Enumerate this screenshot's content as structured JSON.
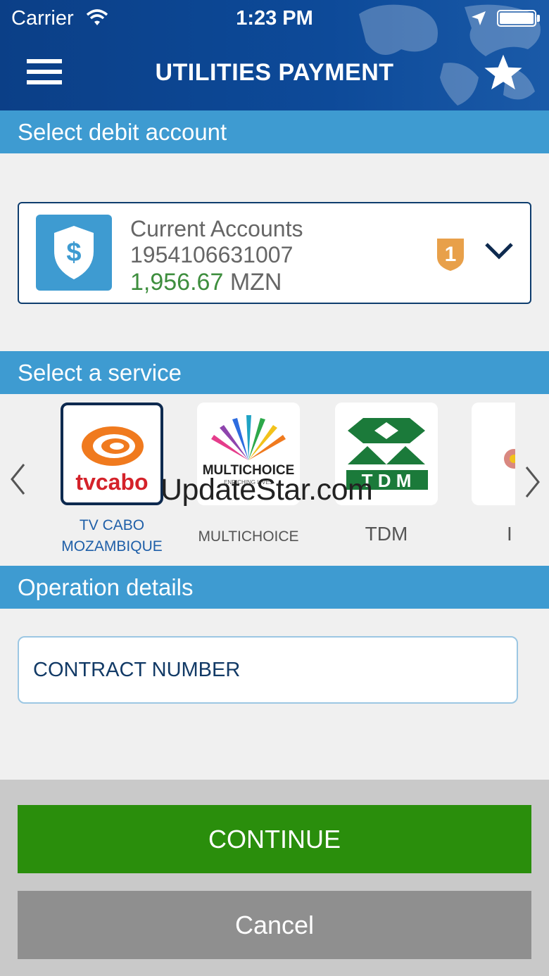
{
  "status_bar": {
    "carrier": "Carrier",
    "time": "1:23 PM"
  },
  "header": {
    "title": "UTILITIES PAYMENT",
    "menu_icon": "hamburger-menu-icon",
    "favorite_icon": "star-icon"
  },
  "debit_section": {
    "heading": "Select debit account",
    "account": {
      "type": "Current Accounts",
      "number": "1954106631007",
      "amount": "1,956.67",
      "currency": "MZN",
      "badge": "1"
    }
  },
  "service_section": {
    "heading": "Select a service",
    "services": [
      {
        "label_line1": "TV CABO",
        "label_line2": "MOZAMBIQUE",
        "logo_text": "tvcabo",
        "selected": true
      },
      {
        "label": "MULTICHOICE",
        "logo_text": "MULTICHOICE",
        "logo_sub": "ENRICHING LIVES",
        "selected": false
      },
      {
        "label": "TDM",
        "logo_text": "T D M",
        "selected": false
      },
      {
        "label": "I",
        "selected": false
      }
    ],
    "watermark": "UpdateStar.com"
  },
  "operation_section": {
    "heading": "Operation details",
    "contract_placeholder": "CONTRACT NUMBER"
  },
  "actions": {
    "continue_label": "CONTINUE",
    "cancel_label": "Cancel"
  },
  "colors": {
    "header_bg": "#0d4a99",
    "section_bg": "#3e9bd1",
    "continue_bg": "#2a8e0c",
    "cancel_bg": "#8f8f8f",
    "balance_green": "#3e8e3e"
  }
}
